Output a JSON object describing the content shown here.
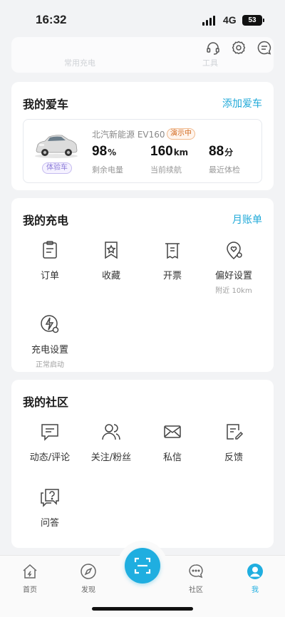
{
  "status": {
    "time": "16:32",
    "network": "4G",
    "battery": "53"
  },
  "header": {
    "faded_left": "常用充电",
    "faded_right": "工具"
  },
  "my_car": {
    "title": "我的爱车",
    "add_label": "添加爱车",
    "car_name": "北汽新能源 EV160",
    "demo_badge": "演示中",
    "trial_badge": "体验车",
    "battery": {
      "value": "98",
      "unit": "%",
      "label": "剩余电量"
    },
    "range": {
      "value": "160",
      "unit": "km",
      "label": "当前续航"
    },
    "check": {
      "value": "88",
      "unit": "分",
      "label": "最近体检"
    }
  },
  "my_charge": {
    "title": "我的充电",
    "link": "月账单",
    "items": [
      {
        "label": "订单",
        "sub": ""
      },
      {
        "label": "收藏",
        "sub": ""
      },
      {
        "label": "开票",
        "sub": ""
      },
      {
        "label": "偏好设置",
        "sub": "附近 10km"
      },
      {
        "label": "充电设置",
        "sub": "正常启动"
      }
    ]
  },
  "my_community": {
    "title": "我的社区",
    "items": [
      {
        "label": "动态/评论"
      },
      {
        "label": "关注/粉丝"
      },
      {
        "label": "私信"
      },
      {
        "label": "反馈"
      },
      {
        "label": "问答"
      }
    ]
  },
  "tabbar": {
    "items": [
      {
        "label": "首页"
      },
      {
        "label": "发现"
      },
      {
        "label": "社区"
      },
      {
        "label": "我"
      }
    ],
    "active_color": "#1faee0"
  }
}
